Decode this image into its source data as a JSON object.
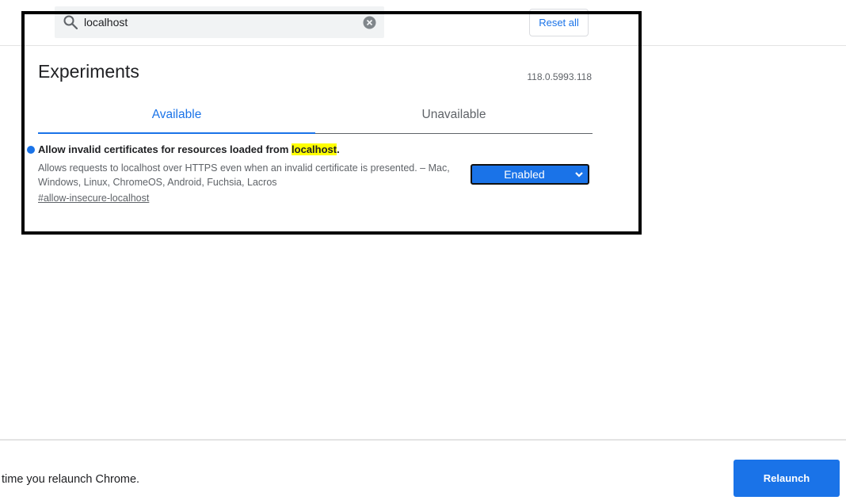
{
  "header": {
    "search": {
      "value": "localhost"
    },
    "reset_label": "Reset all"
  },
  "main": {
    "title": "Experiments",
    "version": "118.0.5993.118",
    "tabs": [
      {
        "label": "Available",
        "active": true
      },
      {
        "label": "Unavailable",
        "active": false
      }
    ],
    "experiments": [
      {
        "title_before": "Allow invalid certificates for resources loaded from ",
        "title_highlight": "localhost",
        "title_after": ".",
        "description": "Allows requests to localhost over HTTPS even when an invalid certificate is presented. – Mac, Windows, Linux, ChromeOS, Android, Fuchsia, Lacros",
        "link": "#allow-insecure-localhost",
        "state": "Enabled"
      }
    ]
  },
  "footer": {
    "message": "time you relaunch Chrome.",
    "relaunch_label": "Relaunch"
  },
  "colors": {
    "accent": "#1a73e8",
    "highlight": "#ffff00",
    "secondary_text": "#5f6368"
  },
  "icons": [
    "search-icon",
    "clear-icon",
    "chevron-down-icon"
  ]
}
